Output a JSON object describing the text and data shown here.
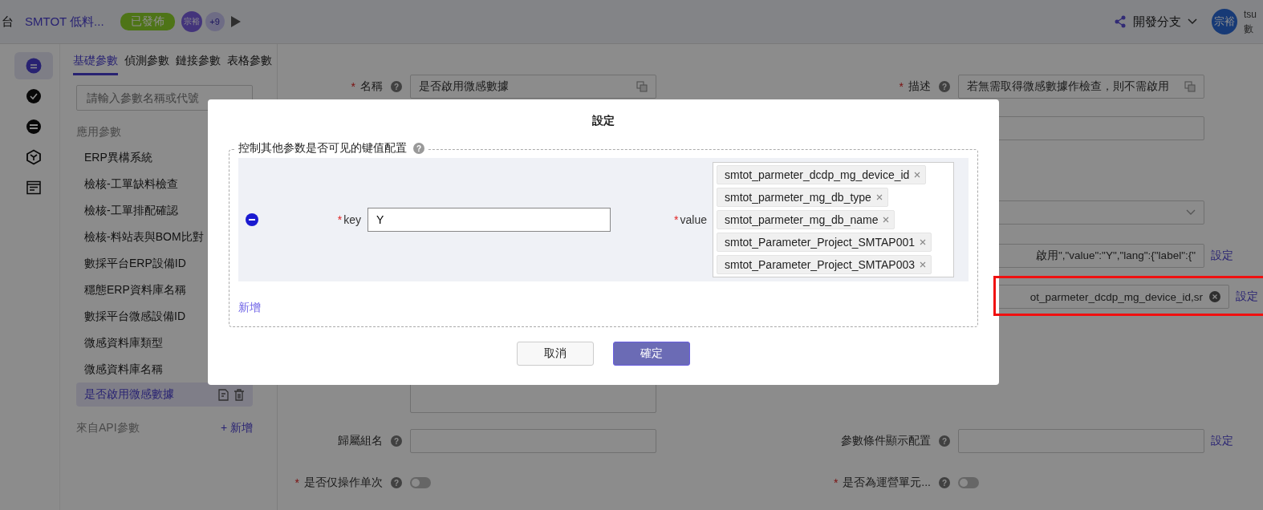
{
  "header": {
    "crumb": "台",
    "app_name": "SMTOT 低料...",
    "status": "已發佈",
    "members": [
      {
        "text": "宗裕",
        "kind": "avatar"
      },
      {
        "text": "+9",
        "kind": "more"
      }
    ],
    "branch": "開發分支",
    "user_avatar": "宗裕",
    "user_name": "tsu",
    "user_org": "數"
  },
  "rail": [
    {
      "kind": "document",
      "selected": true
    },
    {
      "kind": "check",
      "selected": false
    },
    {
      "kind": "list",
      "selected": false
    },
    {
      "kind": "cube",
      "selected": false
    },
    {
      "kind": "form",
      "selected": false
    }
  ],
  "tabs": [
    {
      "label": "基礎參數",
      "selected": true
    },
    {
      "label": "偵測參數",
      "selected": false
    },
    {
      "label": "鏈接參數",
      "selected": false
    },
    {
      "label": "表格參數",
      "selected": false
    }
  ],
  "search": {
    "placeholder": "請輸入參數名稱或代號"
  },
  "groups": [
    {
      "title": "應用參數",
      "items": [
        {
          "label": "ERP異構系統",
          "selected": false
        },
        {
          "label": "檢核-工單缺料檢查",
          "selected": false
        },
        {
          "label": "檢核-工單排配確認",
          "selected": false
        },
        {
          "label": "檢核-料站表與BOM比對",
          "selected": false
        },
        {
          "label": "數採平台ERP設備ID",
          "selected": false
        },
        {
          "label": "穩態ERP資料庫名稱",
          "selected": false
        },
        {
          "label": "數採平台微感設備ID",
          "selected": false
        },
        {
          "label": "微感資料庫類型",
          "selected": false
        },
        {
          "label": "微感資料庫名稱",
          "selected": false
        },
        {
          "label": "是否啟用微感數據",
          "selected": true
        }
      ]
    },
    {
      "title": "來自API參數",
      "action": "+ 新增"
    }
  ],
  "form": {
    "left": [
      {
        "kind": "input",
        "required_mark": "*",
        "label": "名稱",
        "help": "?",
        "value": "是否啟用微感數據",
        "translate": true
      },
      {
        "kind": "textarea"
      },
      {
        "kind": "input",
        "label": "歸屬組名",
        "help": "?"
      },
      {
        "kind": "switch",
        "required_mark": "*",
        "label": "是否仅操作单次",
        "help": "?",
        "on": false
      }
    ],
    "right": [
      {
        "kind": "input",
        "required_mark": "*",
        "label": "描述",
        "help": "?",
        "value": "若無需取得微感數據作檢查，則不需啟用",
        "translate": true
      },
      {
        "kind": "input"
      },
      {
        "kind": "select"
      },
      {
        "kind": "input",
        "value": "啟用\",\"value\":\"Y\",\"lang\":{\"label\":{\"",
        "link": "設定"
      },
      {
        "kind": "input",
        "value": "ot_parmeter_dcdp_mg_device_id,sr",
        "clearable": true,
        "link": "設定",
        "highlighted": true
      },
      {
        "kind": "input",
        "label": "參數條件顯示配置",
        "help": "?",
        "link": "設定"
      },
      {
        "kind": "switch",
        "required_mark": "*",
        "label": "是否為運營單元...",
        "help": "?",
        "on": false
      }
    ]
  },
  "modal": {
    "title": "設定",
    "legend": "控制其他参数是否可见的键值配置",
    "legend_help": "?",
    "required_mark": "*",
    "key_label": "key",
    "value_label": "value",
    "rows": [
      {
        "key": "Y",
        "values": [
          "smtot_parmeter_dcdp_mg_device_id",
          "smtot_parmeter_mg_db_type",
          "smtot_parmeter_mg_db_name",
          "smtot_Parameter_Project_SMTAP001",
          "smtot_Parameter_Project_SMTAP003"
        ]
      }
    ],
    "add": "新增",
    "cancel": "取消",
    "ok": "確定"
  }
}
